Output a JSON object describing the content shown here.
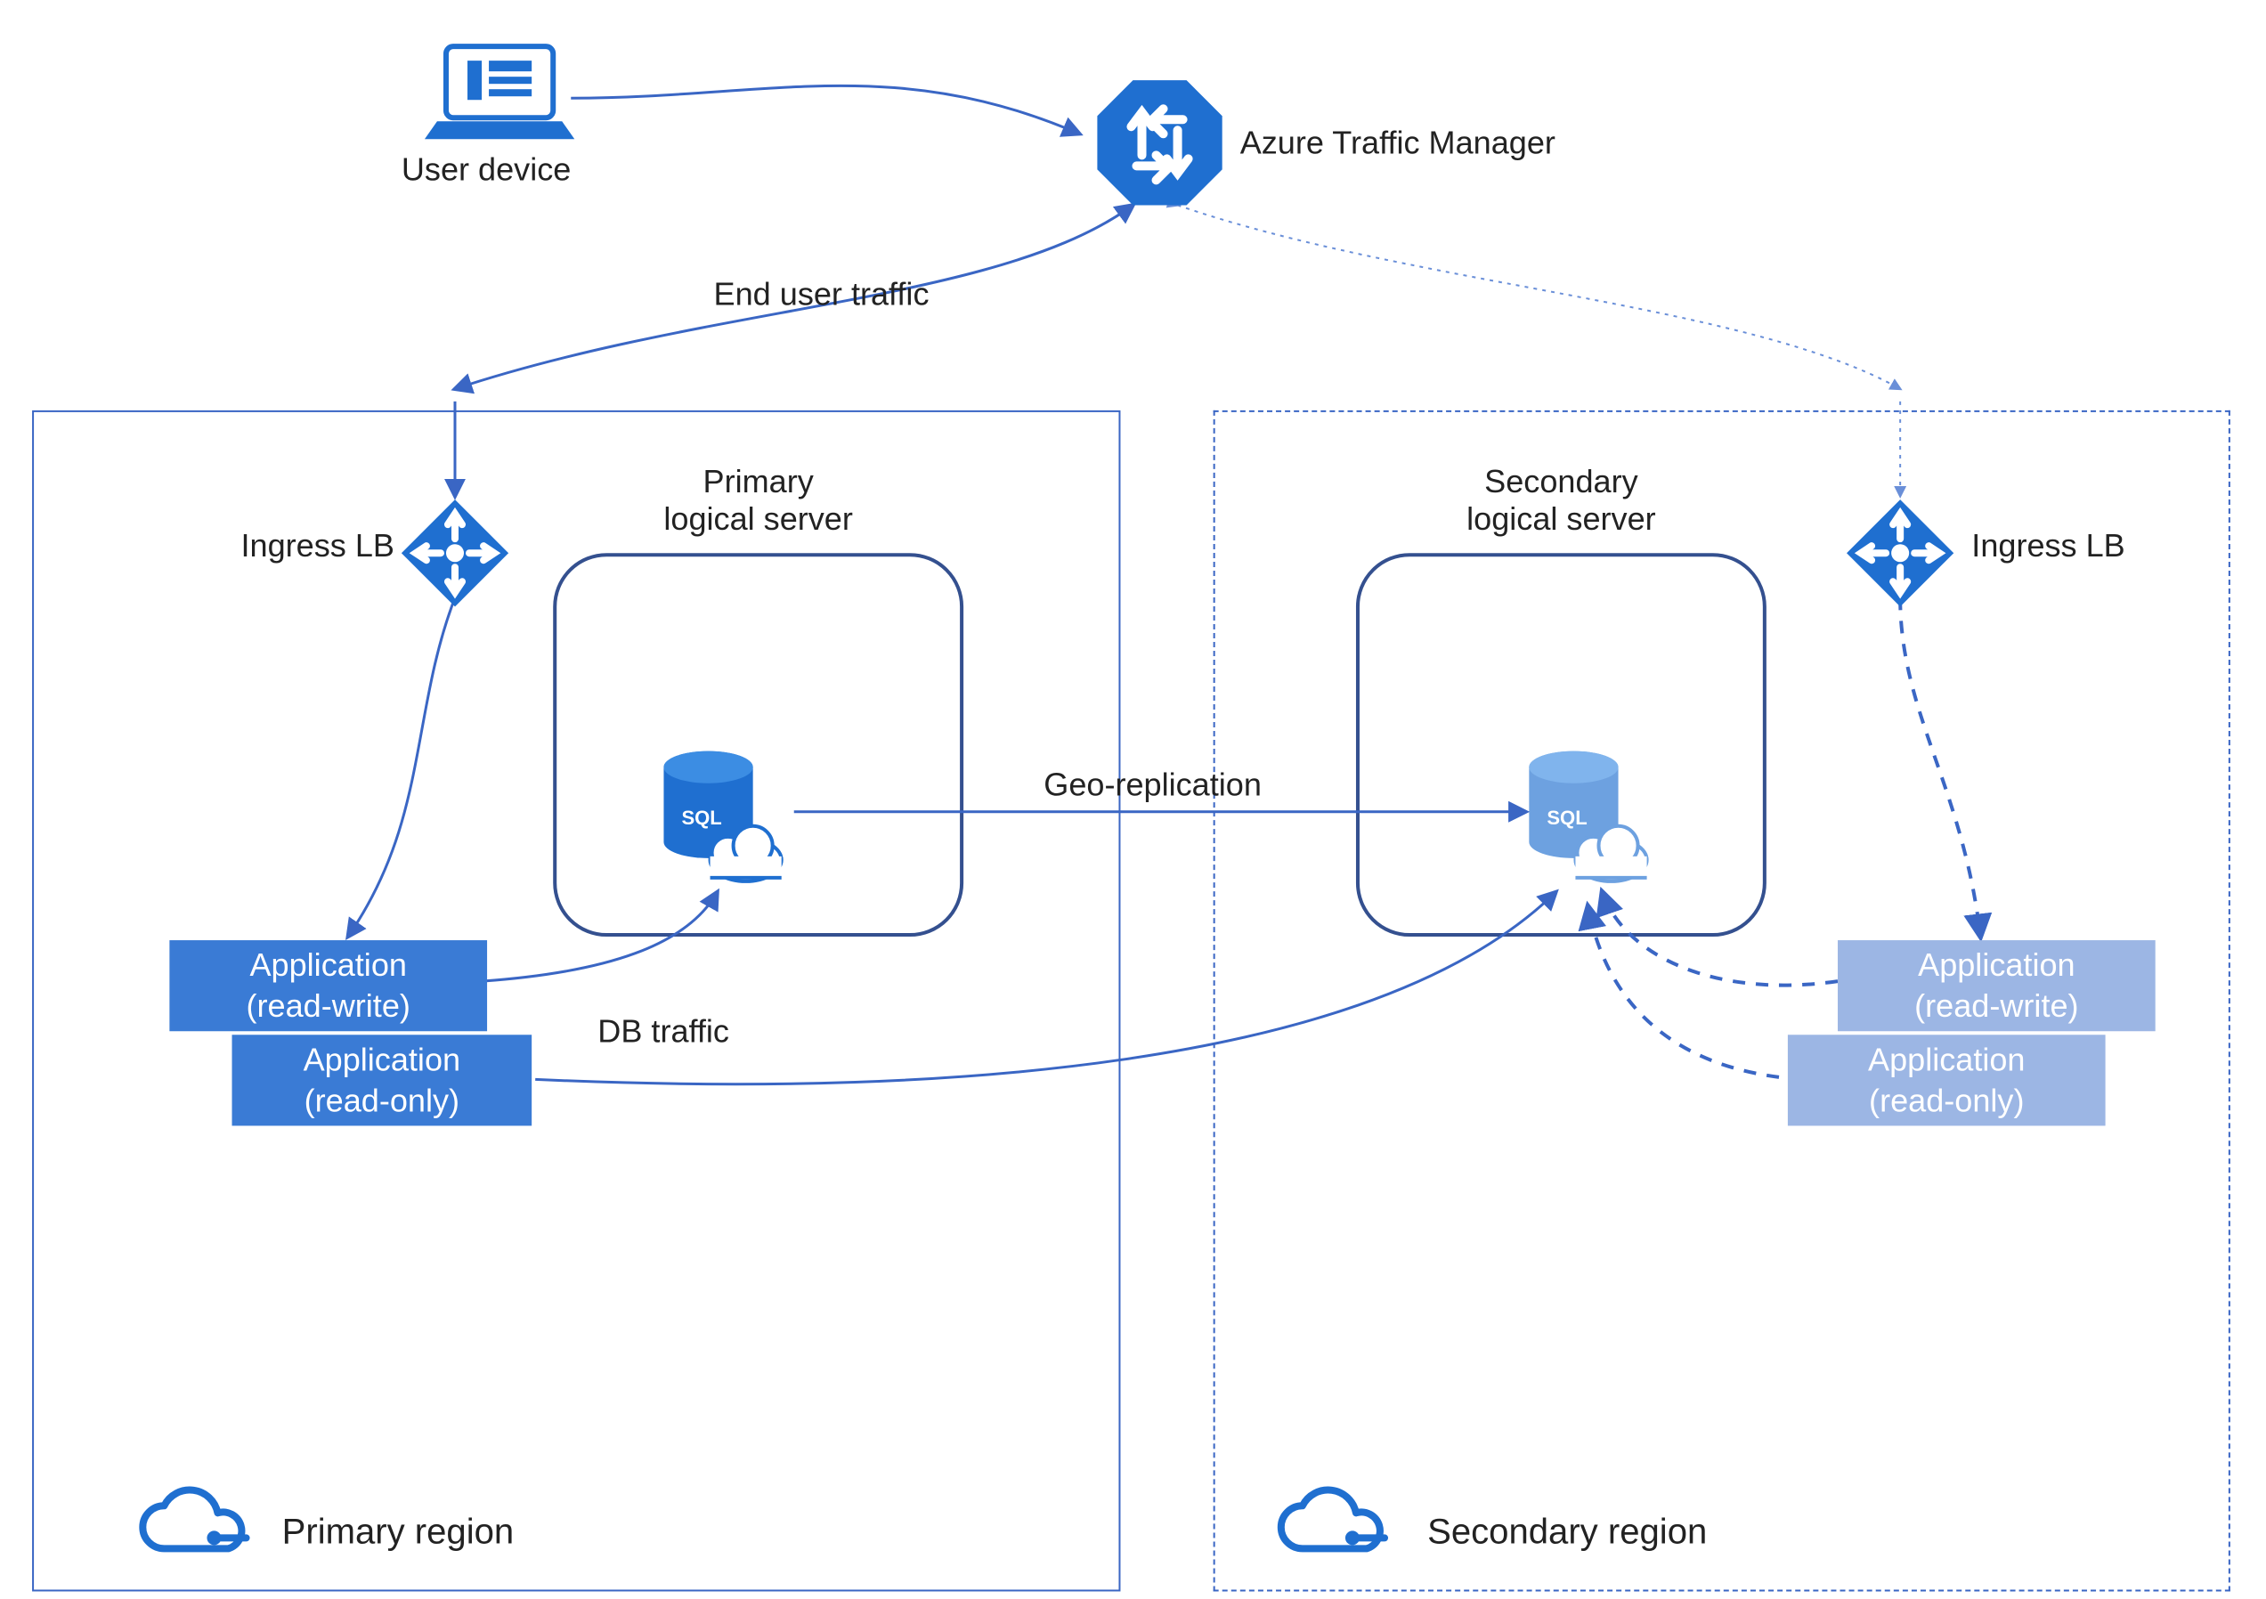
{
  "top": {
    "user_device": "User device",
    "traffic_manager": "Azure Traffic Manager",
    "end_user_traffic": "End user traffic"
  },
  "geo_replication": "Geo-replication",
  "db_traffic": "DB traffic",
  "primary": {
    "region_label": "Primary region",
    "ingress": "Ingress LB",
    "server_title_l1": "Primary",
    "server_title_l2": "logical server",
    "app_rw_l1": "Application",
    "app_rw_l2": "(read-write)",
    "app_ro_l1": "Application",
    "app_ro_l2": "(read-only)"
  },
  "secondary": {
    "region_label": "Secondary region",
    "ingress": "Ingress LB",
    "server_title_l1": "Secondary",
    "server_title_l2": "logical server",
    "app_rw_l1": "Application",
    "app_rw_l2": "(read-write)",
    "app_ro_l1": "Application",
    "app_ro_l2": "(read-only)"
  }
}
